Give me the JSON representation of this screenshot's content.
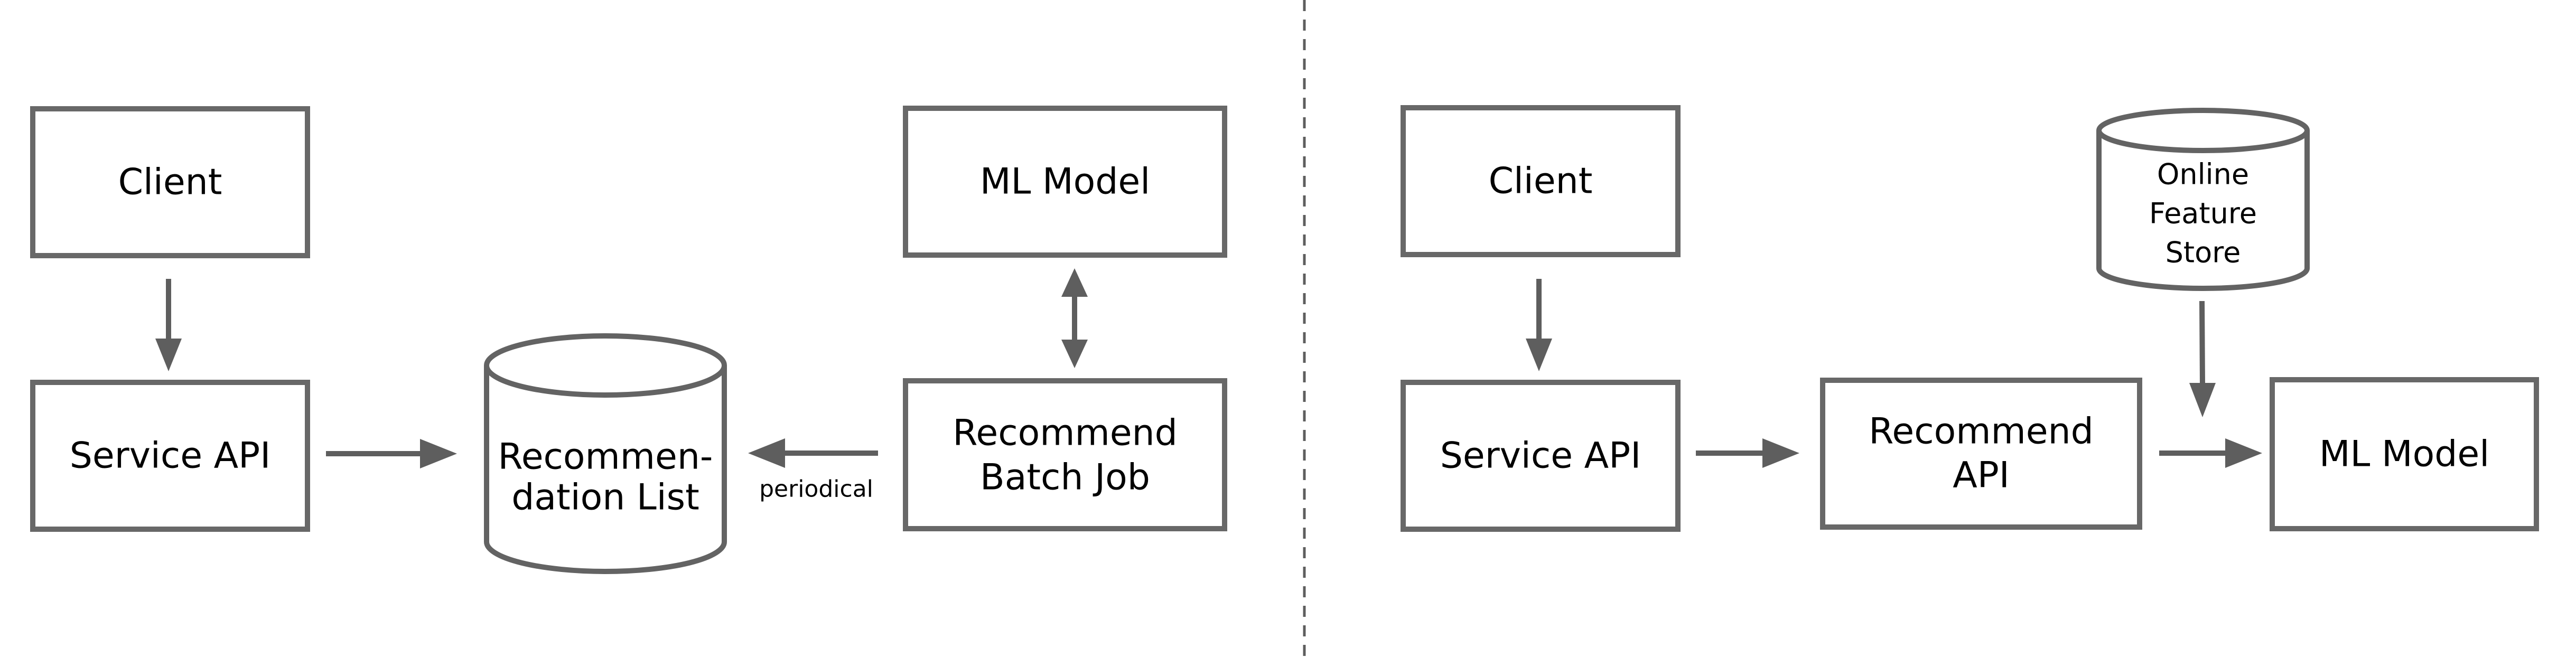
{
  "left_diagram": {
    "client": {
      "label": "Client"
    },
    "service_api": {
      "label": "Service API"
    },
    "recommendation_list": {
      "lines": [
        "Recommen-",
        "dation List"
      ]
    },
    "ml_model": {
      "label": "ML Model"
    },
    "batch_job": {
      "lines": [
        "Recommend",
        "Batch Job"
      ]
    },
    "edge_periodic": {
      "label": "periodical"
    }
  },
  "right_diagram": {
    "client": {
      "label": "Client"
    },
    "service_api": {
      "label": "Service API"
    },
    "recommend_api": {
      "lines": [
        "Recommend",
        "API"
      ]
    },
    "ml_model": {
      "label": "ML Model"
    },
    "feature_store": {
      "lines": [
        "Online",
        "Feature",
        "Store"
      ]
    }
  },
  "colors": {
    "box_stroke": "#686868",
    "arrow": "#5e5e5e",
    "text": "#000000",
    "background": "#ffffff"
  }
}
